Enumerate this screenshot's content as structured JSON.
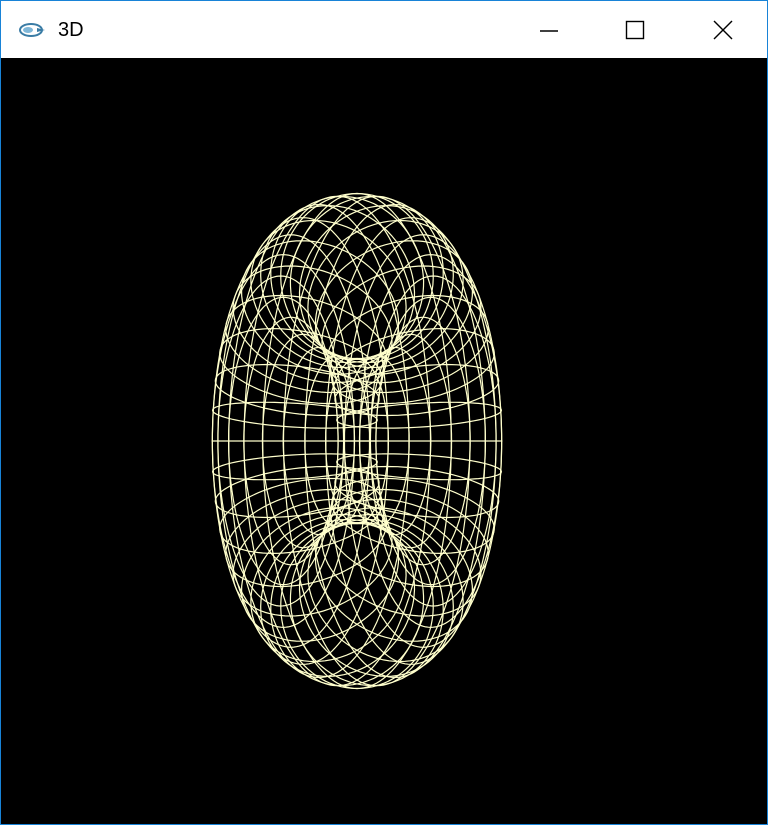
{
  "window": {
    "title": "3D",
    "controls": {
      "minimize": "minimize",
      "maximize": "maximize",
      "close": "close"
    }
  },
  "canvas": {
    "background_color": "#000000",
    "wire_color": "#ffffcc",
    "shape": "torus-wireframe"
  },
  "colors": {
    "window_border": "#1883d7",
    "titlebar": "#ffffff"
  }
}
